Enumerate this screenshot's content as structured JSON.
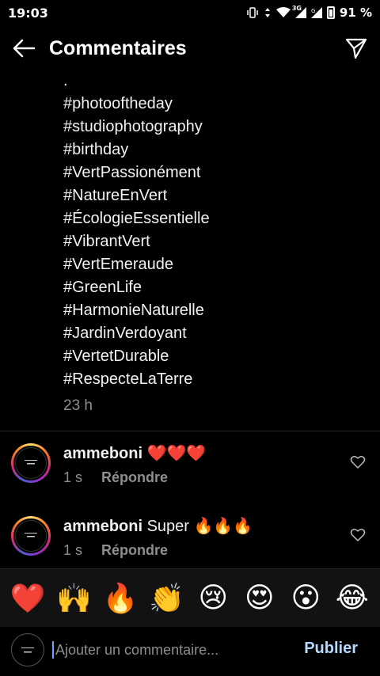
{
  "status_bar": {
    "time": "19:03",
    "network_label": "3G",
    "battery_percent": "91 %",
    "icons": [
      "vibrate-icon",
      "data-arrows-icon",
      "wifi-icon",
      "signal-3g-icon",
      "signal-g-icon",
      "battery-icon"
    ]
  },
  "header": {
    "title": "Commentaires",
    "back_icon": "arrow-left-icon",
    "send_icon": "paper-plane-icon"
  },
  "caption": {
    "lines": [
      ".",
      "#photooftheday",
      "#studiophotography",
      "#birthday",
      "#VertPassionément",
      "#NatureEnVert",
      "#ÉcologieEssentielle",
      "#VibrantVert",
      "#VertEmeraude",
      "#GreenLife",
      "#HarmonieNaturelle",
      "#JardinVerdoyant",
      "#VertetDurable",
      "#RespecteLaTerre"
    ],
    "time": "23 h"
  },
  "comments": [
    {
      "username": "ammeboni",
      "text": "❤️❤️❤️",
      "time": "1 s",
      "reply_label": "Répondre"
    },
    {
      "username": "ammeboni",
      "text": "Super 🔥🔥🔥",
      "time": "1 s",
      "reply_label": "Répondre"
    }
  ],
  "emoji_bar": [
    "❤️",
    "🙌",
    "🔥",
    "👏",
    "😢",
    "😍",
    "😮",
    "😂"
  ],
  "input": {
    "placeholder": "Ajouter un commentaire...",
    "publish_label": "Publier"
  },
  "colors": {
    "background": "#000000",
    "muted_text": "#8e8e8e",
    "publish_button": "#b3dbff",
    "emoji_bar_bg": "#121212"
  }
}
